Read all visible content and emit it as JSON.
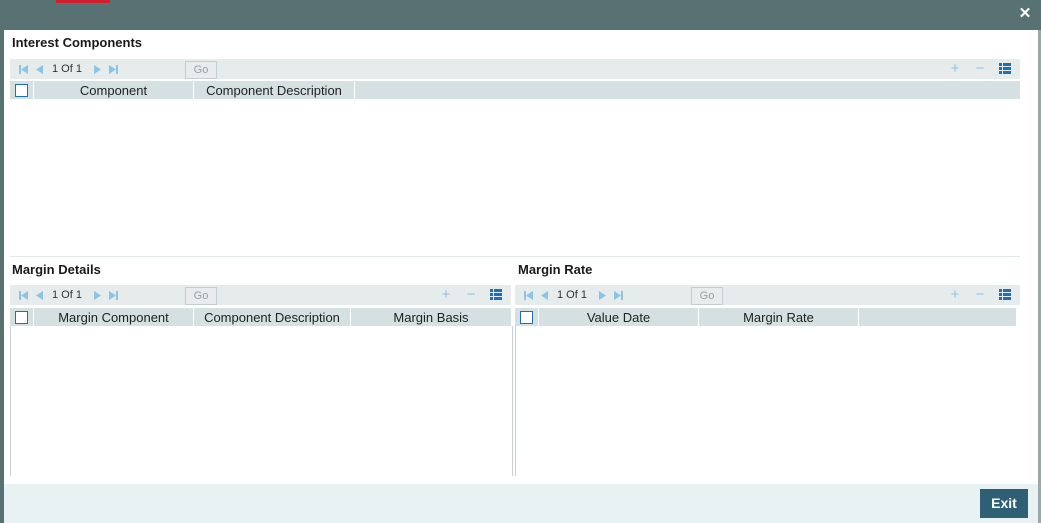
{
  "window": {
    "close_icon": "close-icon",
    "close_glyph": "✕"
  },
  "interest_components": {
    "title": "Interest Components",
    "pager": {
      "text": "1 Of 1",
      "go_label": "Go"
    },
    "columns": [
      "Component",
      "Component Description"
    ],
    "rows": []
  },
  "margin_details": {
    "title": "Margin Details",
    "pager": {
      "text": "1 Of 1",
      "go_label": "Go"
    },
    "columns": [
      "Margin Component",
      "Component Description",
      "Margin Basis"
    ],
    "rows": []
  },
  "margin_rate": {
    "title": "Margin Rate",
    "pager": {
      "text": "1 Of 1",
      "go_label": "Go"
    },
    "columns": [
      "Value Date",
      "Margin Rate"
    ],
    "rows": []
  },
  "toolbar_icons": {
    "add": "+",
    "remove": "−"
  },
  "footer": {
    "exit_label": "Exit"
  },
  "colors": {
    "header_bar": "#587274",
    "accent": "#d02030",
    "exit_button": "#2e5f75",
    "icon_blue": "#8cc4e6",
    "grid_header": "#d5e0e3"
  }
}
